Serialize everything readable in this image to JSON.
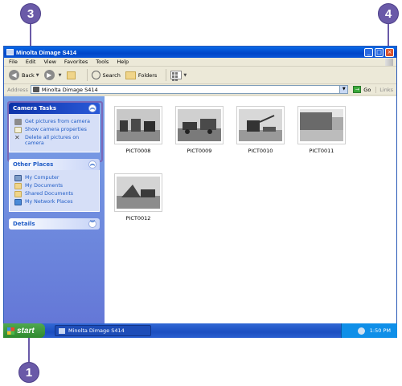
{
  "callouts": {
    "c1": "1",
    "c3": "3",
    "c4": "4"
  },
  "window": {
    "title": "Minolta Dimage S414"
  },
  "menu": [
    "File",
    "Edit",
    "View",
    "Favorites",
    "Tools",
    "Help"
  ],
  "toolbar": {
    "back": "Back",
    "search": "Search",
    "folders": "Folders"
  },
  "address": {
    "label": "Address",
    "value": "Minolta Dimage S414",
    "go": "Go",
    "links": "Links"
  },
  "camera_tasks": {
    "title": "Camera Tasks",
    "items": [
      "Get pictures from camera",
      "Show camera properties",
      "Delete all pictures on camera"
    ]
  },
  "other_places": {
    "title": "Other Places",
    "items": [
      "My Computer",
      "My Documents",
      "Shared Documents",
      "My Network Places"
    ]
  },
  "details": {
    "title": "Details"
  },
  "pictures": [
    "PICT0008",
    "PICT0009",
    "PICT0010",
    "PICT0011",
    "PICT0012"
  ],
  "taskbar": {
    "start": "start",
    "task": "Minolta Dimage S414",
    "clock": "1:50 PM"
  },
  "colors": {
    "callout": "#6a5aa8",
    "titlebar": "#0046c8",
    "taskpane": "#6f8cdf",
    "start": "#2e8a2e"
  }
}
